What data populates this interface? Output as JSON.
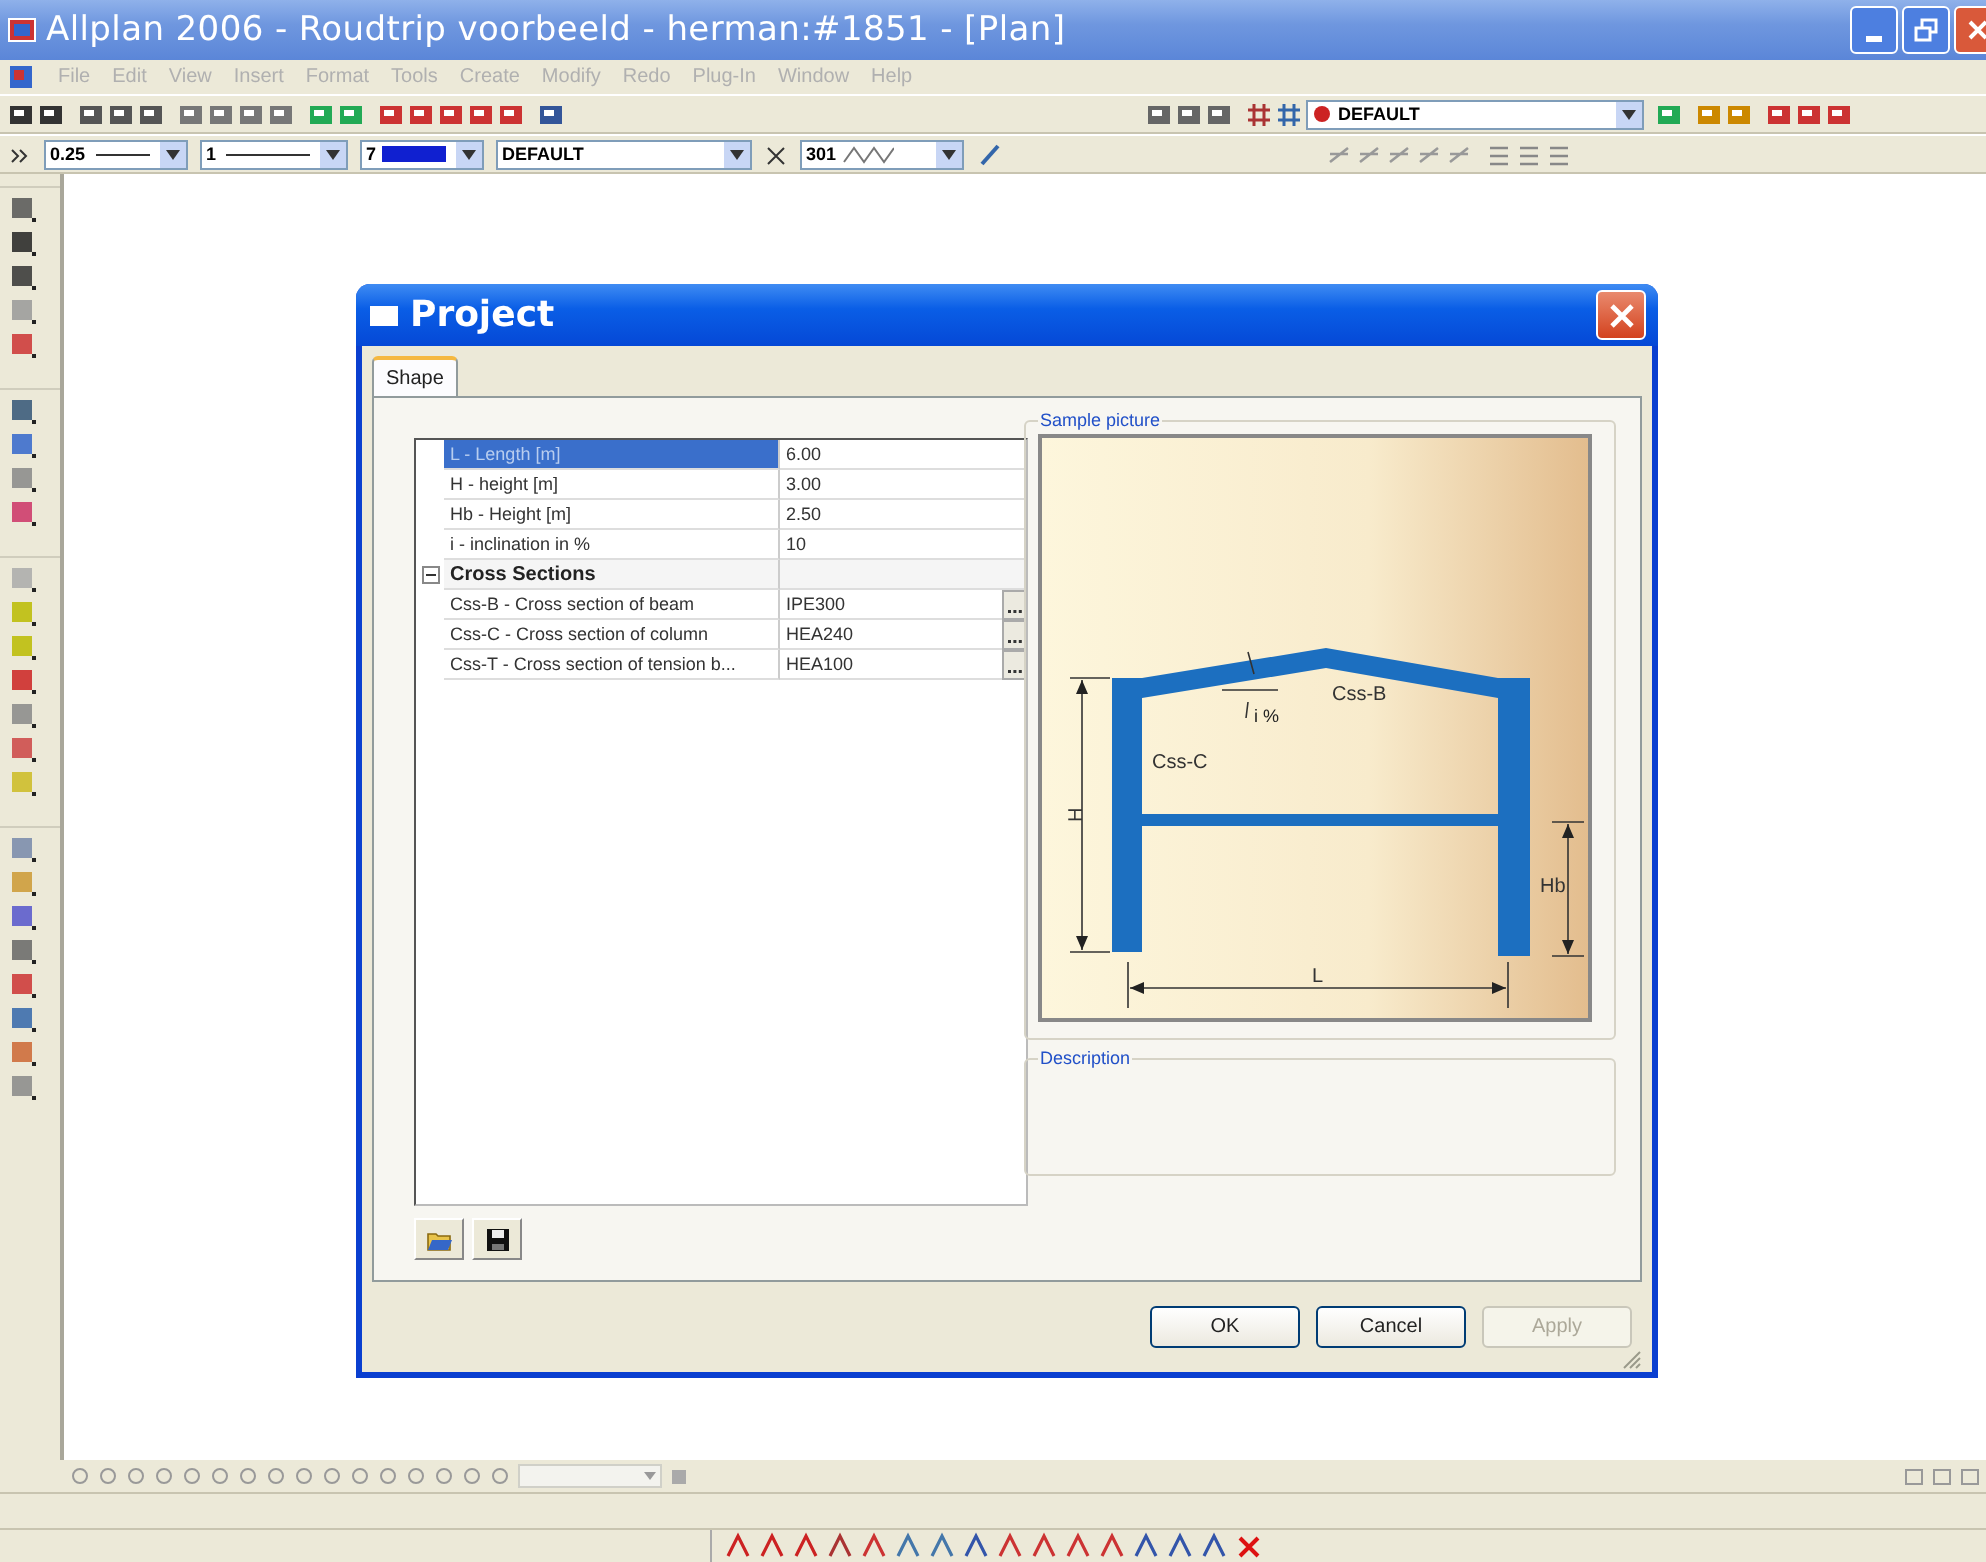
{
  "window": {
    "title": "Allplan 2006 - Roudtrip voorbeeld - herman:#1851 - [Plan]"
  },
  "menu": [
    {
      "label": "File",
      "disabled": true
    },
    {
      "label": "Edit",
      "disabled": true
    },
    {
      "label": "View",
      "disabled": true
    },
    {
      "label": "Insert",
      "disabled": true
    },
    {
      "label": "Format",
      "disabled": true
    },
    {
      "label": "Tools",
      "disabled": true
    },
    {
      "label": "Create",
      "disabled": true
    },
    {
      "label": "Modify",
      "disabled": true
    },
    {
      "label": "Redo",
      "disabled": true
    },
    {
      "label": "Plug-In",
      "disabled": true
    },
    {
      "label": "Window",
      "disabled": true
    },
    {
      "label": "Help",
      "disabled": true
    }
  ],
  "standard_toolbar": {
    "layer_combo": "DEFAULT"
  },
  "format_toolbar": {
    "pen": "0.25",
    "line": "1",
    "color_index": "7",
    "layer": "DEFAULT",
    "pattern": "301"
  },
  "dialog": {
    "title": "Project",
    "tabs": [
      {
        "label": "Shape",
        "selected": true
      }
    ],
    "properties": [
      {
        "kind": "field",
        "label": "L - Length [m]",
        "value": "6.00",
        "selected": true
      },
      {
        "kind": "field",
        "label": "H - height [m]",
        "value": "3.00",
        "selected": false
      },
      {
        "kind": "field",
        "label": "Hb - Height [m]",
        "value": "2.50",
        "selected": false
      },
      {
        "kind": "field",
        "label": "i - inclination in %",
        "value": "10",
        "selected": false
      },
      {
        "kind": "group",
        "label": "Cross Sections",
        "expanded": true,
        "selected": false,
        "children": [
          {
            "kind": "picker",
            "label": "Css-B - Cross section of beam",
            "value": "IPE300",
            "selected": false
          },
          {
            "kind": "picker",
            "label": "Css-C - Cross section of column",
            "value": "HEA240",
            "selected": false
          },
          {
            "kind": "picker",
            "label": "Css-T - Cross section of tension b...",
            "value": "HEA100",
            "selected": false
          }
        ]
      }
    ],
    "sample_picture": {
      "label": "Sample picture",
      "beam": "Css-B",
      "column": "Css-C",
      "inclination": "i %",
      "height": "H",
      "tie_height": "Hb",
      "length": "L"
    },
    "description": {
      "label": "Description"
    },
    "buttons": [
      {
        "label": "OK",
        "disabled": false
      },
      {
        "label": "Cancel",
        "disabled": false
      },
      {
        "label": "Apply",
        "disabled": true
      }
    ]
  }
}
